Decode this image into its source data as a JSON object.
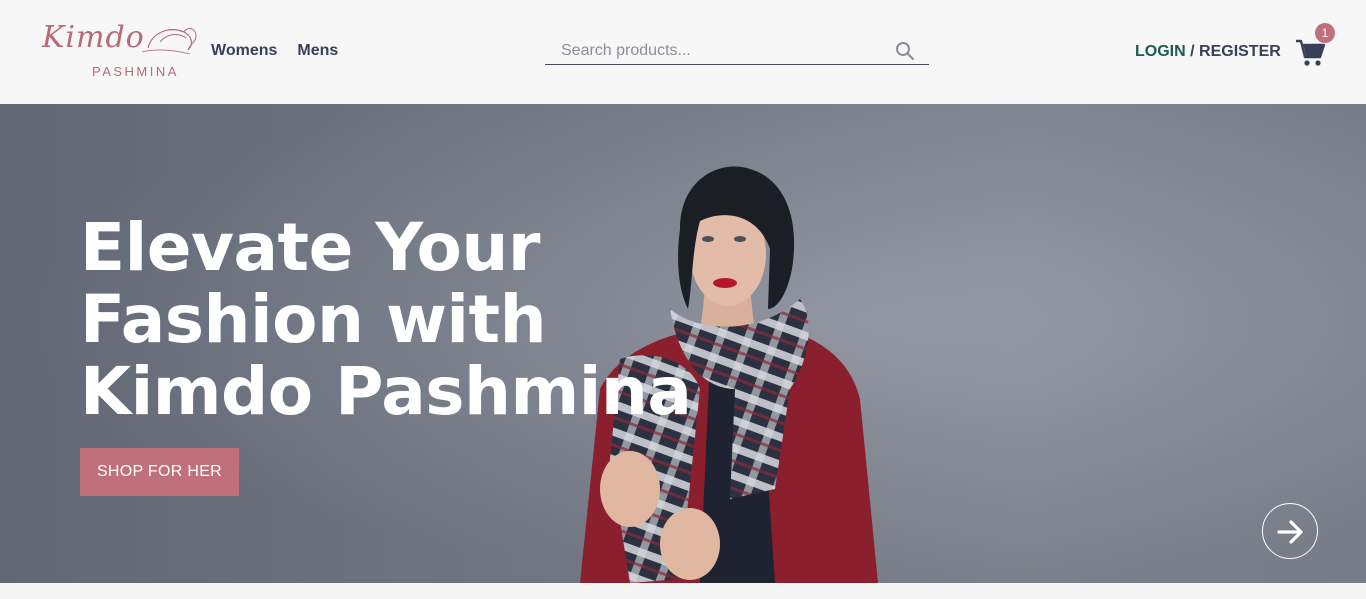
{
  "brand": {
    "script": "Kimdo",
    "sub": "PASHMINA",
    "color": "#b86a78"
  },
  "nav": {
    "items": [
      {
        "label": "Womens"
      },
      {
        "label": "Mens"
      }
    ]
  },
  "search": {
    "placeholder": "Search products...",
    "icon": "search-icon"
  },
  "auth": {
    "login": "LOGIN",
    "separator": " / ",
    "register": "REGISTER"
  },
  "cart": {
    "icon": "cart-icon",
    "count": "1"
  },
  "hero": {
    "title": "Elevate Your Fashion with Kimdo Pashmina",
    "cta": "SHOP FOR HER",
    "next_icon": "arrow-right-icon",
    "accent": "#c0707a"
  }
}
